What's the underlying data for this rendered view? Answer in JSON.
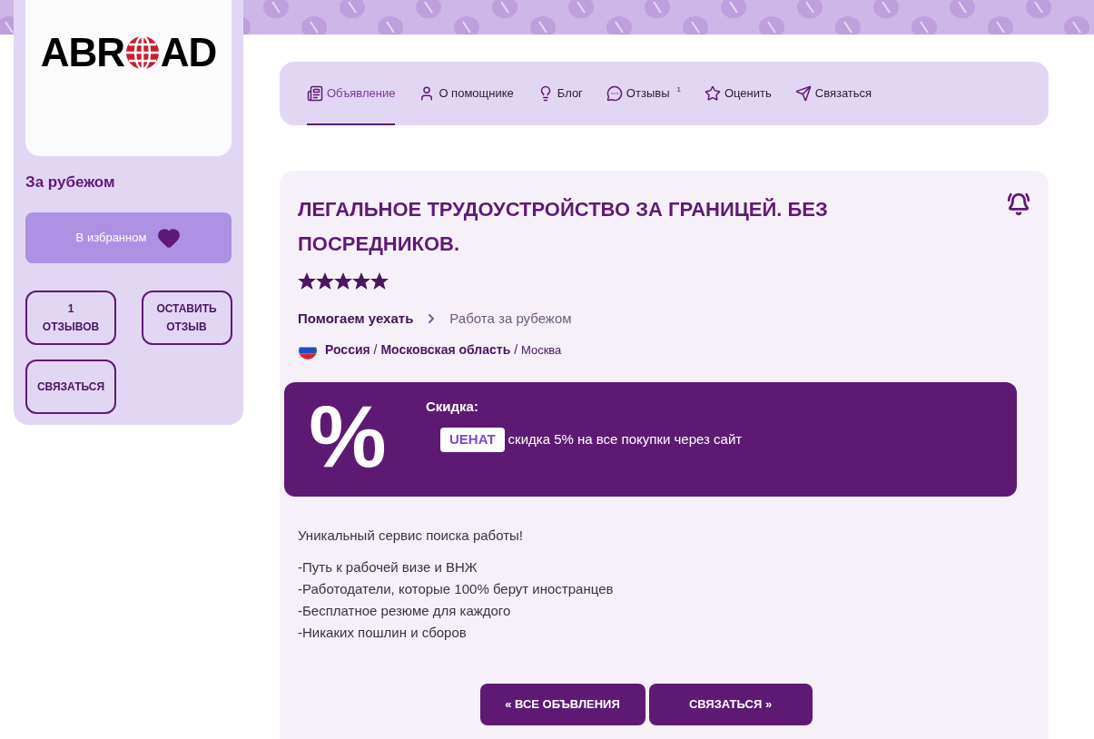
{
  "sidebar": {
    "logo": {
      "left": "ABR",
      "right": "AD"
    },
    "name": "За рубежом",
    "favorite": {
      "label": "В избранном",
      "selected": true
    },
    "buttons": [
      {
        "lines": [
          "1",
          "ОТЗЫВОВ"
        ]
      },
      {
        "lines": [
          "ОСТАВИТЬ",
          "ОТЗЫВ"
        ]
      },
      {
        "lines": [
          "СВЯЗАТЬСЯ"
        ]
      }
    ]
  },
  "tabs": [
    {
      "kind": "news",
      "label": "Объявление",
      "selected": true
    },
    {
      "kind": "user",
      "label": "О помощнике",
      "selected": false
    },
    {
      "kind": "bulb",
      "label": "Блог",
      "selected": false
    },
    {
      "kind": "chat",
      "label": "Отзывы",
      "count": "1",
      "selected": false
    },
    {
      "kind": "star",
      "label": "Оценить",
      "selected": false
    },
    {
      "kind": "send",
      "label": "Связаться",
      "selected": false
    }
  ],
  "listing": {
    "title": "ЛЕГАЛЬНОЕ ТРУДОУСТРОЙСТВО ЗА ГРАНИЦЕЙ. БЕЗ ПОСРЕДНИКОВ.",
    "stars": 5,
    "breadcrumb": {
      "category": "Помогаем уехать",
      "subcategory": "Работа за рубежом"
    },
    "location": {
      "country": "Россия",
      "region": "Московская область",
      "city": "Москва",
      "separator": "/"
    },
    "discount": {
      "symbol": "%",
      "heading": "Скидка:",
      "code": "UEHAT",
      "text": "скидка 5% на все покупки через сайт"
    },
    "description": [
      "Уникальный сервис поиска работы!"
    ],
    "bullets": [
      "-Путь к рабочей визе и ВНЖ",
      "-Работодатели, которые 100% берут иностранцев",
      "-Бесплатное резюме для каждого",
      "-Никаких пошлин и сборов"
    ],
    "actions": [
      "« ВСЕ ОБЪВЛЕНИЯ",
      "СВЯЗАТЬСЯ »"
    ]
  }
}
